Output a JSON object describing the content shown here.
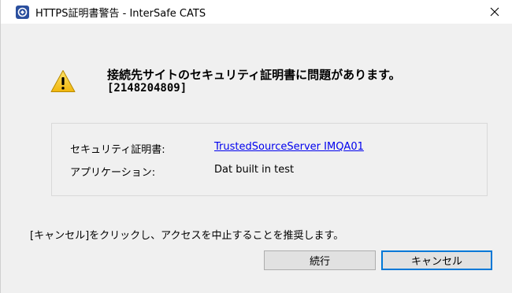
{
  "window": {
    "title": "HTTPS証明書警告 - InterSafe CATS",
    "app_icon": "intersafe-logo-icon",
    "close_icon": "close-icon"
  },
  "message": {
    "icon": "warning-icon",
    "text": "接続先サイトのセキュリティ証明書に問題があります。",
    "code": "[2148204809]"
  },
  "details": {
    "certificate_label": "セキュリティ証明書:",
    "certificate_value": "TrustedSourceServer IMQA01",
    "application_label": "アプリケーション:",
    "application_value": "Dat built in test"
  },
  "recommendation": "[キャンセル]をクリックし、アクセスを中止することを推奨します。",
  "buttons": {
    "continue_label": "続行",
    "cancel_label": "キャンセル"
  },
  "colors": {
    "link": "#0000ee",
    "focus_border": "#0078d7",
    "warning_fill": "#f5c518"
  }
}
